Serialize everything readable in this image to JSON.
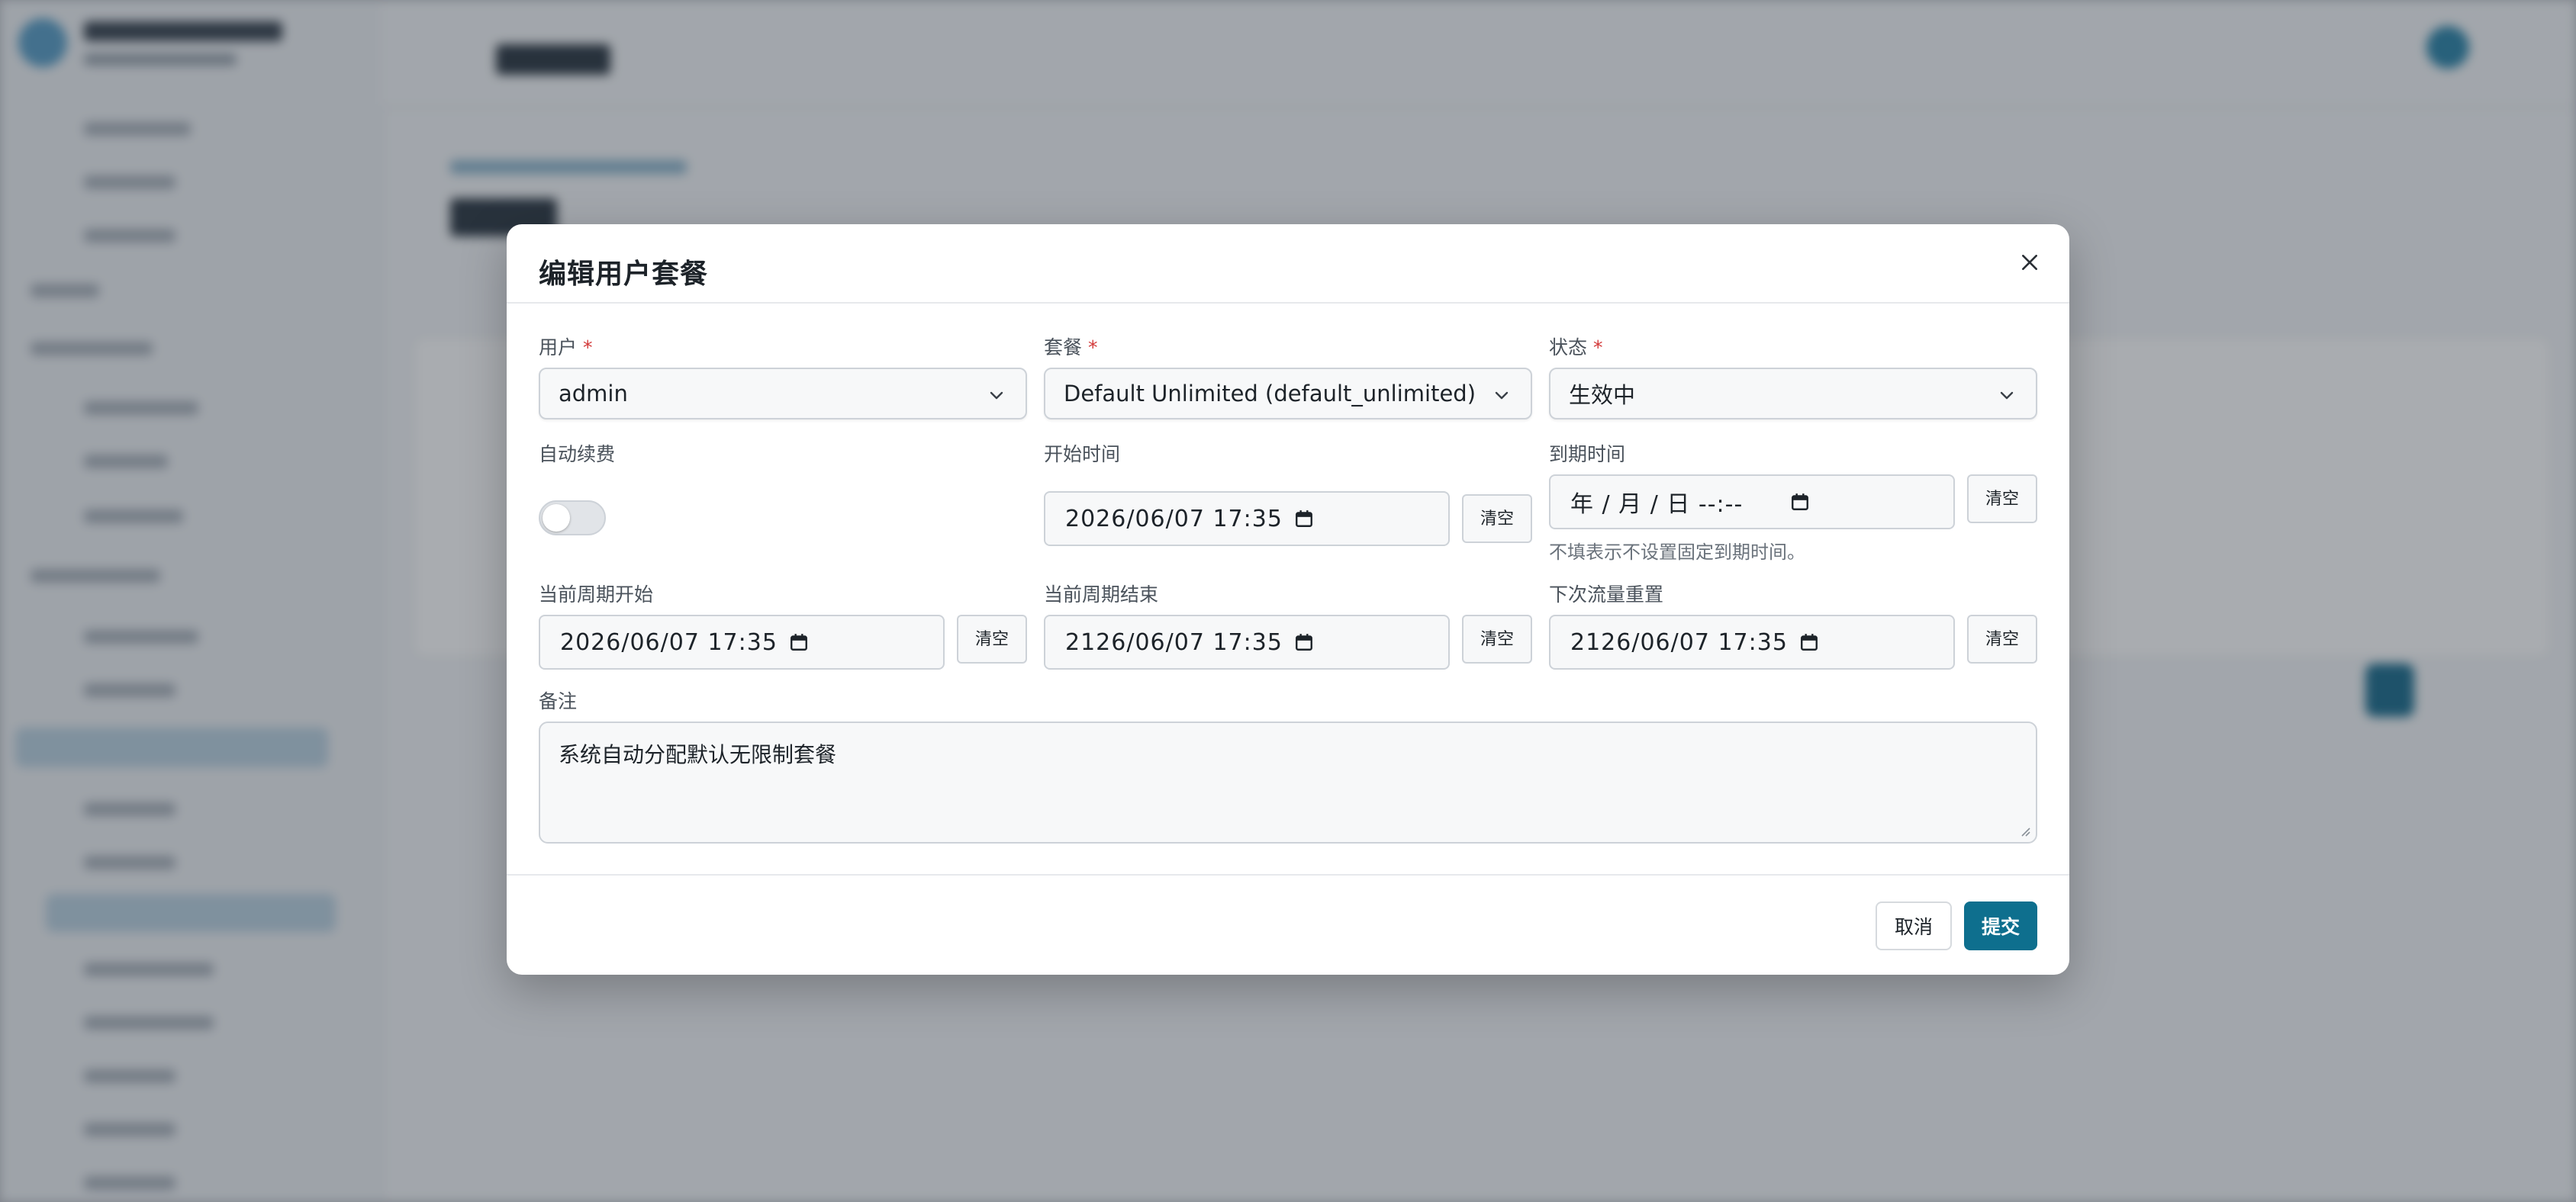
{
  "modal": {
    "title": "编辑用户套餐",
    "close_icon": "close-icon"
  },
  "fields": {
    "user": {
      "label": "用户",
      "required_mark": "*",
      "value": "admin"
    },
    "plan": {
      "label": "套餐",
      "required_mark": "*",
      "value": "Default Unlimited (default_unlimited)"
    },
    "status": {
      "label": "状态",
      "required_mark": "*",
      "value": "生效中"
    },
    "auto_renew": {
      "label": "自动续费",
      "enabled": false
    },
    "start_time": {
      "label": "开始时间",
      "value": "2026/06/07 17:35",
      "clear_label": "清空"
    },
    "expire_time": {
      "label": "到期时间",
      "value": "年 / 月 / 日 --:--",
      "clear_label": "清空",
      "hint": "不填表示不设置固定到期时间。"
    },
    "period_start": {
      "label": "当前周期开始",
      "value": "2026/06/07 17:35",
      "clear_label": "清空"
    },
    "period_end": {
      "label": "当前周期结束",
      "value": "2126/06/07 17:35",
      "clear_label": "清空"
    },
    "next_reset": {
      "label": "下次流量重置",
      "value": "2126/06/07 17:35",
      "clear_label": "清空"
    },
    "note": {
      "label": "备注",
      "value": "系统自动分配默认无限制套餐"
    }
  },
  "footer": {
    "cancel_label": "取消",
    "submit_label": "提交"
  },
  "colors": {
    "primary": "#0e6f8e",
    "required": "#d33a3a",
    "border": "#cdd2d8"
  }
}
